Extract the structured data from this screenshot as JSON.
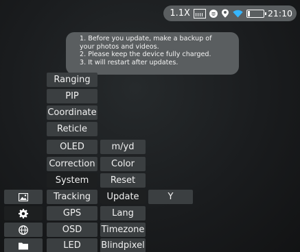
{
  "status_bar": {
    "zoom": "1.1X",
    "time": "21:10",
    "icons": [
      "image-mode-icon",
      "record-icon",
      "location-icon",
      "wifi-icon",
      "battery-icon"
    ],
    "battery_level": 0.15
  },
  "notice": {
    "lines": [
      "1. Before you update, make a backup of",
      "your photos and videos.",
      "2. Please keep the device fully charged.",
      "3. It will restart after updates."
    ]
  },
  "menu": {
    "column1": [
      "Ranging",
      "PIP",
      "Coordinate",
      "Reticle",
      "OLED",
      "Correction",
      "System",
      "Tracking",
      "GPS",
      "OSD",
      "LED"
    ],
    "column2": [
      "m/yd",
      "Color",
      "Reset",
      "Update",
      "Lang",
      "Timezone",
      "Blindpixel"
    ],
    "column3": [
      "Y"
    ],
    "selected_column1": "System",
    "selected_column2": "Update"
  },
  "sidebar": {
    "icons": [
      "image-icon",
      "settings-gear-icon",
      "globe-icon",
      "folder-icon"
    ],
    "selected": "settings-gear-icon"
  },
  "colors": {
    "item_bg": "#3b3f41",
    "selected_bg": "#1d1f20",
    "panel_bg": "#5a5e60",
    "wifi": "#36b6ff"
  }
}
